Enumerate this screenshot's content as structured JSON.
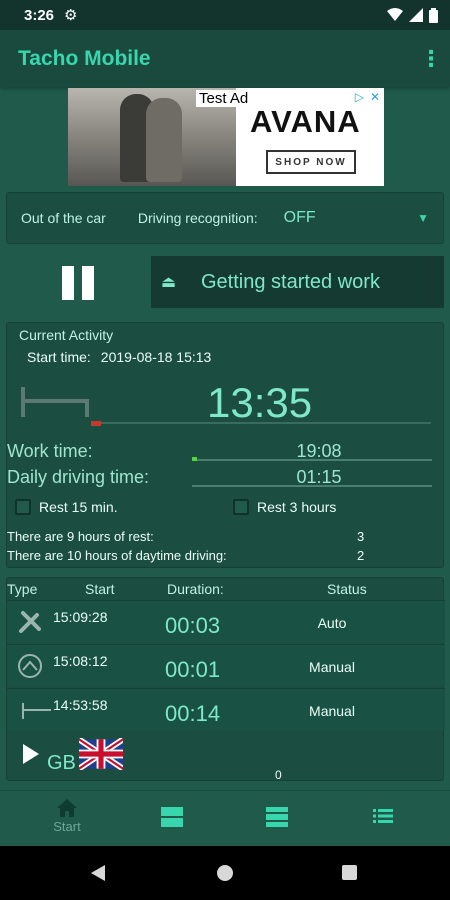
{
  "statusbar": {
    "time": "3:26"
  },
  "appbar": {
    "title": "Tacho Mobile"
  },
  "ad": {
    "test_label": "Test Ad",
    "brand": "AVANA",
    "cta": "SHOP NOW"
  },
  "driving_bar": {
    "status": "Out of the car",
    "recognition_label": "Driving recognition:",
    "recognition_value": "OFF"
  },
  "controls": {
    "start_work_label": "Getting started work"
  },
  "current_activity": {
    "header": "Current Activity",
    "start_time_label": "Start time:",
    "start_time_value": "2019-08-18 15:13",
    "duration": "13:35",
    "work_time_label": "Work time:",
    "work_time_value": "19:08",
    "work_time_progress": 0.02,
    "daily_driving_label": "Daily driving time:",
    "daily_driving_value": "01:15",
    "daily_driving_progress": 0.0,
    "rest15_label": "Rest 15 min.",
    "rest3_label": "Rest 3 hours",
    "stat1_label": "There are 9 hours of rest:",
    "stat1_value": "3",
    "stat2_label": "There are 10 hours of daytime driving:",
    "stat2_value": "2"
  },
  "history": {
    "columns": [
      "Type",
      "Start",
      "Duration:",
      "Status"
    ],
    "rows": [
      {
        "icon": "tools-icon",
        "start": "15:09:28",
        "duration": "00:03",
        "status": "Auto"
      },
      {
        "icon": "steering-wheel-icon",
        "start": "15:08:12",
        "duration": "00:01",
        "status": "Manual"
      },
      {
        "icon": "bed-icon",
        "start": "14:53:58",
        "duration": "00:14",
        "status": "Manual"
      }
    ],
    "country": "GB",
    "count": "0"
  },
  "bottom_nav": {
    "tabs": [
      {
        "label": "Start",
        "icon": "home-icon"
      },
      {
        "label": "",
        "icon": "split-view-icon"
      },
      {
        "label": "",
        "icon": "list-view-icon"
      },
      {
        "label": "",
        "icon": "list-icon"
      }
    ]
  },
  "colors": {
    "accent": "#38d6ad",
    "background": "#1f5a4a",
    "progress": "#5ad13f"
  }
}
